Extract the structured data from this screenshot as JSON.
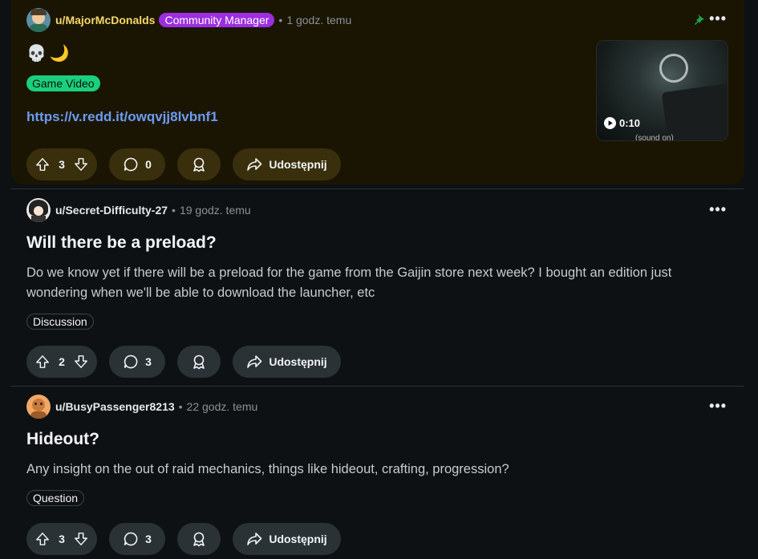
{
  "posts": [
    {
      "username": "u/MajorMcDonalds",
      "role": "Community Manager",
      "time": "1 godz. temu",
      "emoji": "💀🌙",
      "flair": "Game Video",
      "link": "https://v.redd.it/owqvjj8lvbnf1",
      "video_duration": "0:10",
      "video_sound": "(sound on)",
      "votes": "3",
      "comments": "0",
      "share_label": "Udostępnij",
      "pinned": true
    },
    {
      "username": "u/Secret-Difficulty-27",
      "time": "19 godz. temu",
      "title": "Will there be a preload?",
      "body": "Do we know yet if there will be a preload for the game from the Gaijin store next week? I bought an edition just wondering when we'll be able to download the launcher, etc",
      "flair": "Discussion",
      "votes": "2",
      "comments": "3",
      "share_label": "Udostępnij"
    },
    {
      "username": "u/BusyPassenger8213",
      "time": "22 godz. temu",
      "title": "Hideout?",
      "body": "Any insight on the out of raid mechanics, things like hideout, crafting, progression?",
      "flair": "Question",
      "votes": "3",
      "comments": "3",
      "share_label": "Udostępnij"
    }
  ],
  "separator": "•",
  "more_label": "•••",
  "icons": {
    "upvote": "arrow-up-icon",
    "downvote": "arrow-down-icon",
    "comment": "comment-bubble-icon",
    "award": "award-icon",
    "share": "share-arrow-icon",
    "pin": "pin-icon",
    "play": "play-icon"
  },
  "colors": {
    "background": "#0e1113",
    "pinned_background": "#1a1503",
    "community_manager": "#9d2ee0",
    "game_video_flair": "#1bd07a",
    "link": "#6c9cf0",
    "pin": "#1ea34a"
  }
}
